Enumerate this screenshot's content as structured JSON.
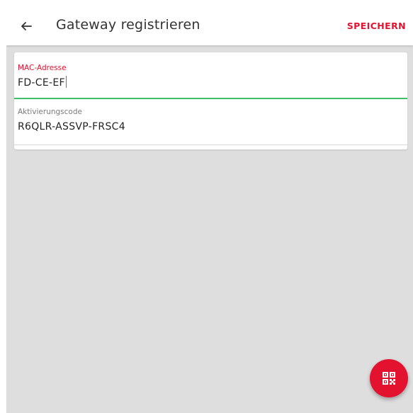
{
  "appbar": {
    "title": "Gateway registrieren",
    "save_label": "SPEICHERN",
    "back_icon": "arrow-left-icon"
  },
  "form": {
    "mac": {
      "label": "MAC-Adresse",
      "value": "FD-CE-EF"
    },
    "activation": {
      "label": "Aktivierungscode",
      "value": "R6QLR-ASSVP-FRSC4"
    }
  },
  "fab": {
    "icon": "qr-code-icon"
  },
  "colors": {
    "accent": "#e3132f",
    "focus_underline": "#3fbf6a",
    "background": "#dedede"
  }
}
